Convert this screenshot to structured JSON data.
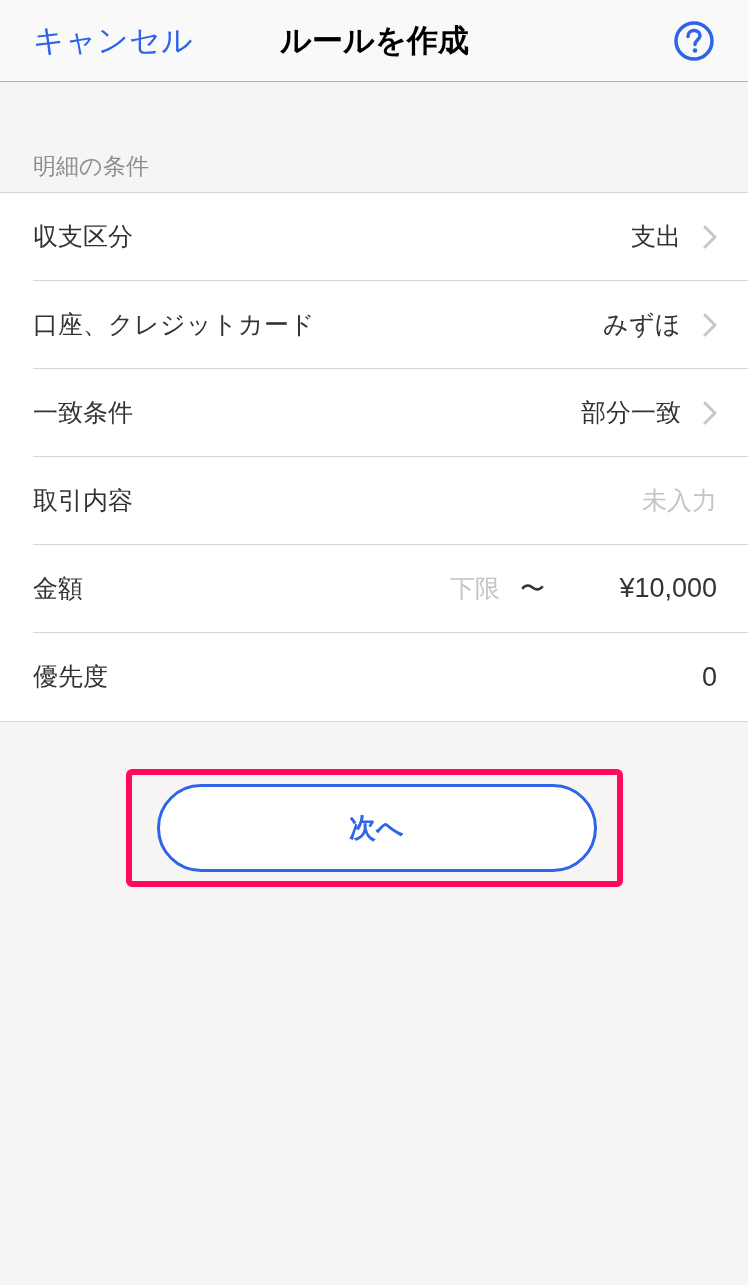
{
  "header": {
    "cancel": "キャンセル",
    "title": "ルールを作成"
  },
  "section": {
    "title": "明細の条件"
  },
  "rows": [
    {
      "kind": "select",
      "label": "収支区分",
      "value": "支出"
    },
    {
      "kind": "select",
      "label": "口座、クレジットカード",
      "value": "みずほ"
    },
    {
      "kind": "select",
      "label": "一致条件",
      "value": "部分一致"
    },
    {
      "kind": "text",
      "label": "取引内容",
      "placeholder": "未入力"
    },
    {
      "kind": "range",
      "label": "金額",
      "min": {
        "placeholder": "下限"
      },
      "separator": "〜",
      "max": {
        "value": "¥10,000"
      }
    },
    {
      "kind": "value",
      "label": "優先度",
      "value": "0"
    }
  ],
  "next_button": {
    "label": "次へ",
    "highlighted": true
  }
}
